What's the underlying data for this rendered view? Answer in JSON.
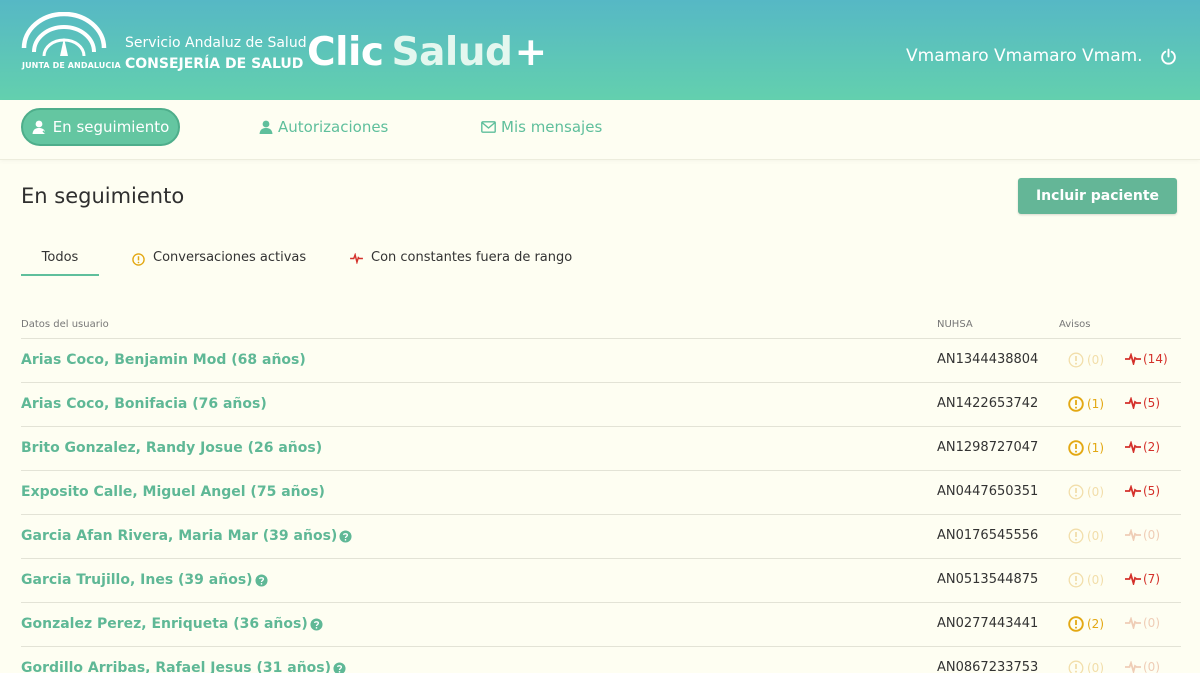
{
  "header": {
    "logo_caption": "JUNTA DE ANDALUCIA",
    "org_line1": "Servicio Andaluz de Salud",
    "org_line2": "CONSEJERÍA DE SALUD",
    "brand_part1": "Clic",
    "brand_part2": "Salud",
    "brand_plus": "+",
    "user_name": "Vmamaro Vmamaro Vmam...",
    "icons": [
      "junta-logo",
      "power-icon"
    ]
  },
  "nav": {
    "items": [
      {
        "label": "En seguimiento",
        "icon": "user-follow-icon",
        "active": true
      },
      {
        "label": "Autorizaciones",
        "icon": "user-auth-icon",
        "active": false
      },
      {
        "label": "Mis mensajes",
        "icon": "envelope-icon",
        "active": false
      }
    ]
  },
  "page": {
    "title": "En seguimiento",
    "include_button": "Incluir paciente"
  },
  "filters": [
    {
      "label": "Todos",
      "active": true
    },
    {
      "label": "Conversaciones activas",
      "icon": "exclamation-circle-icon"
    },
    {
      "label": "Con constantes fuera de rango",
      "icon": "pulse-icon"
    }
  ],
  "table": {
    "headers": {
      "user": "Datos del usuario",
      "nuhsa": "NUHSA",
      "alerts": "Avisos"
    },
    "rows": [
      {
        "name": "Arias Coco, Benjamin Mod (68 años)",
        "help": false,
        "nuhsa": "AN1344438804",
        "msgs": "(0)",
        "msgs_on": false,
        "vitals": "(14)",
        "vitals_on": true
      },
      {
        "name": "Arias Coco, Bonifacia (76 años)",
        "help": false,
        "nuhsa": "AN1422653742",
        "msgs": "(1)",
        "msgs_on": true,
        "vitals": "(5)",
        "vitals_on": true
      },
      {
        "name": "Brito Gonzalez, Randy Josue (26 años)",
        "help": false,
        "nuhsa": "AN1298727047",
        "msgs": "(1)",
        "msgs_on": true,
        "vitals": "(2)",
        "vitals_on": true
      },
      {
        "name": "Exposito Calle, Miguel Angel (75 años)",
        "help": false,
        "nuhsa": "AN0447650351",
        "msgs": "(0)",
        "msgs_on": false,
        "vitals": "(5)",
        "vitals_on": true
      },
      {
        "name": "Garcia Afan Rivera, Maria Mar (39 años)",
        "help": true,
        "nuhsa": "AN0176545556",
        "msgs": "(0)",
        "msgs_on": false,
        "vitals": "(0)",
        "vitals_on": false
      },
      {
        "name": "Garcia Trujillo, Ines (39 años)",
        "help": true,
        "nuhsa": "AN0513544875",
        "msgs": "(0)",
        "msgs_on": false,
        "vitals": "(7)",
        "vitals_on": true
      },
      {
        "name": "Gonzalez Perez, Enriqueta (36 años)",
        "help": true,
        "nuhsa": "AN0277443441",
        "msgs": "(2)",
        "msgs_on": true,
        "vitals": "(0)",
        "vitals_on": false
      },
      {
        "name": "Gordillo Arribas, Rafael Jesus (31 años)",
        "help": true,
        "nuhsa": "AN0867233753",
        "msgs": "(0)",
        "msgs_on": false,
        "vitals": "(0)",
        "vitals_on": false
      }
    ]
  },
  "colors": {
    "header_start": "#56b8c5",
    "header_end": "#63d0ae",
    "accent": "#64c6a1",
    "link": "#5fb896",
    "warning": "#e3a813",
    "danger": "#d4312b",
    "background": "#fefef2"
  }
}
